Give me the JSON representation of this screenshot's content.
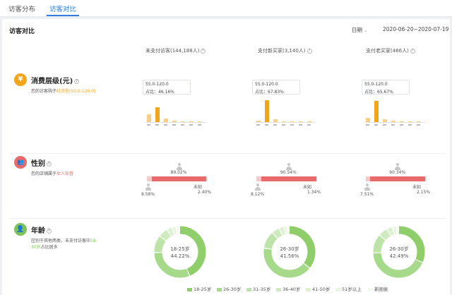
{
  "tabs": [
    {
      "label": "访客分布",
      "active": false
    },
    {
      "label": "访客对比",
      "active": true
    }
  ],
  "panel": {
    "title": "访客对比",
    "date_mode": "日期",
    "date_range": "2020-06-20~2020-07-19"
  },
  "columns": [
    {
      "label": "未支付访客(144,188人)"
    },
    {
      "label": "支付新买家(3,140人)"
    },
    {
      "label": "支付老买家(466人)"
    }
  ],
  "rows": {
    "spending": {
      "icon": "yen-icon",
      "title": "消费层级(元)",
      "desc_prefix": "您的访客购于",
      "desc_highlight": "经济型(55.0-120.0)",
      "color": "#f2a51a",
      "charts": [
        {
          "tip_range": "55.0-120.0",
          "tip_ratio": "占比：46.16%",
          "values": [
            24,
            46,
            12,
            5,
            2,
            2,
            1
          ],
          "highlight_index": 1
        },
        {
          "tip_range": "55.0-120.0",
          "tip_ratio": "占比：67.83%",
          "values": [
            5,
            68,
            8,
            3,
            1,
            1,
            1
          ],
          "highlight_index": 1
        },
        {
          "tip_range": "55.0-120.0",
          "tip_ratio": "占比：65.67%",
          "values": [
            14,
            66,
            9,
            4,
            3,
            2,
            1
          ],
          "highlight_index": 1
        }
      ]
    },
    "gender": {
      "icon": "people-icon",
      "title": "性别",
      "desc_prefix": "您的店铺属于",
      "desc_highlight": "女人知音",
      "color": "#e86a6a",
      "charts": [
        {
          "female": "89.02%",
          "male": "8.58%",
          "unknown_label": "未知",
          "unknown": "2.40%",
          "female_frac": 0.8902,
          "male_frac": 0.0858
        },
        {
          "female": "90.54%",
          "male": "8.12%",
          "unknown_label": "未知",
          "unknown": "1.34%",
          "female_frac": 0.9054,
          "male_frac": 0.0812
        },
        {
          "female": "90.34%",
          "male": "7.51%",
          "unknown_label": "未知",
          "unknown": "2.15%",
          "female_frac": 0.9034,
          "male_frac": 0.0751
        }
      ]
    },
    "age": {
      "icon": "person-icon",
      "title": "年龄",
      "desc_line1_a": "区别于其他两类，未支付访客中",
      "desc_line1_b": "18-",
      "desc_line2_a": "30岁",
      "desc_line2_b": "占比居多",
      "color": "#7cc45a",
      "charts": [
        {
          "center_label": "18-25岁",
          "center_value": "44.22%",
          "slices": [
            44.22,
            30.5,
            11.0,
            6.0,
            3.3,
            2.5,
            2.48
          ]
        },
        {
          "center_label": "26-30岁",
          "center_value": "41.56%",
          "slices": [
            36.0,
            41.56,
            11.0,
            5.0,
            3.0,
            2.0,
            1.44
          ]
        },
        {
          "center_label": "26-30岁",
          "center_value": "42.49%",
          "slices": [
            32.0,
            42.49,
            12.0,
            6.0,
            3.5,
            2.5,
            1.51
          ]
        }
      ]
    }
  },
  "legend": [
    {
      "label": "18-25岁",
      "color": "#8fce6b"
    },
    {
      "label": "26-30岁",
      "color": "#a6d98a"
    },
    {
      "label": "31-35岁",
      "color": "#bde3a8"
    },
    {
      "label": "36-40岁",
      "color": "#cfeabf"
    },
    {
      "label": "41-50岁",
      "color": "#ddf0d1"
    },
    {
      "label": "51岁以上",
      "color": "#e9f5e1"
    },
    {
      "label": "新围侯",
      "color": "#f3f9ee"
    }
  ],
  "ui": {
    "help_glyph": "?"
  }
}
